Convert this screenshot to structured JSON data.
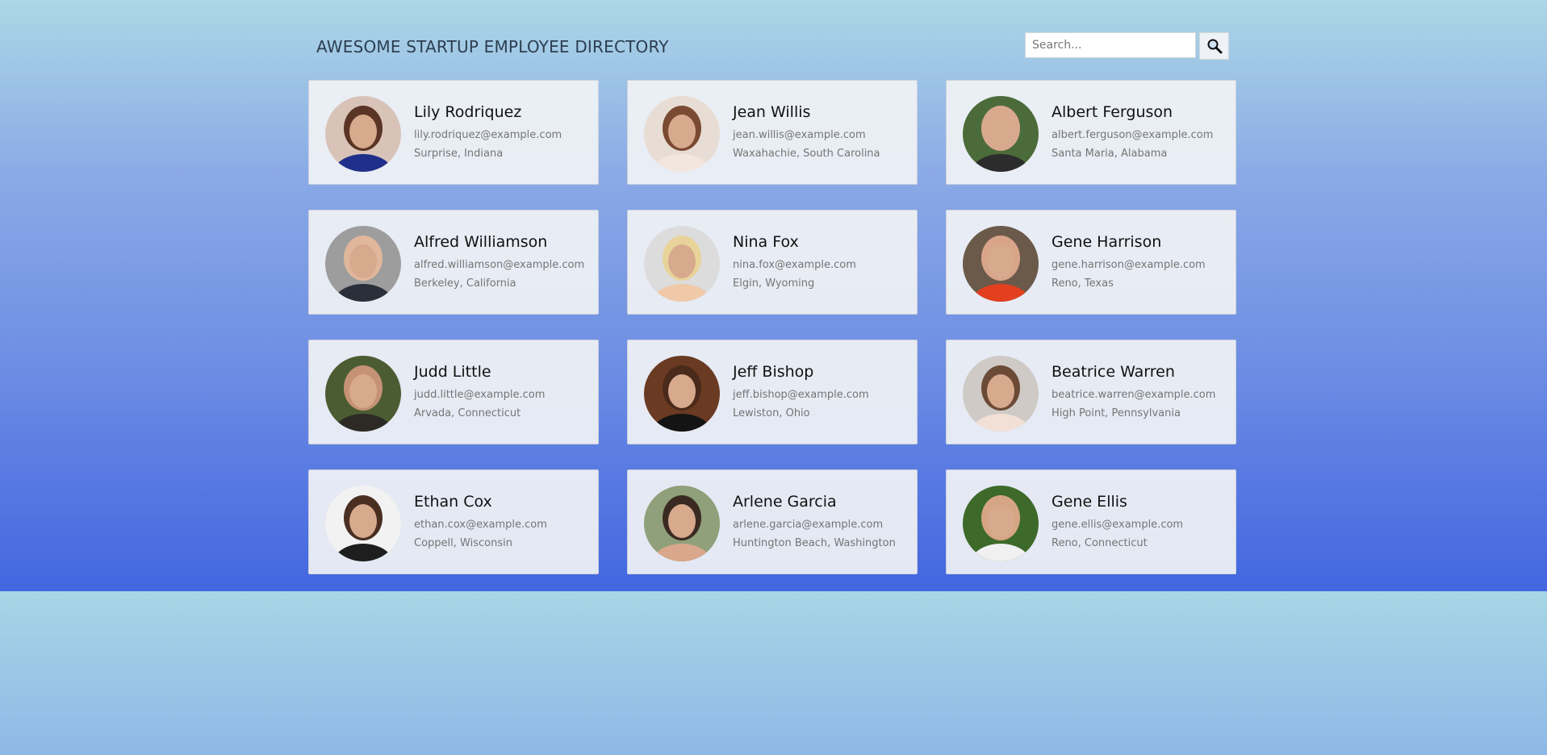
{
  "header": {
    "title": "AWESOME STARTUP EMPLOYEE DIRECTORY"
  },
  "search": {
    "placeholder": "Search...",
    "value": "",
    "button_icon": "magnifying-glass-icon"
  },
  "employees": [
    {
      "name": "Lily Rodriquez",
      "email": "lily.rodriquez@example.com",
      "location": "Surprise, Indiana",
      "avatar_colors": [
        "#d9c3b8",
        "#5a3424",
        "#1f2f8a"
      ]
    },
    {
      "name": "Jean Willis",
      "email": "jean.willis@example.com",
      "location": "Waxahachie, South Carolina",
      "avatar_colors": [
        "#e8ddd4",
        "#7a4a32",
        "#f2e6df"
      ]
    },
    {
      "name": "Albert Ferguson",
      "email": "albert.ferguson@example.com",
      "location": "Santa Maria, Alabama",
      "avatar_colors": [
        "#4c6b3a",
        "#d9a98e",
        "#2c2c2c"
      ]
    },
    {
      "name": "Alfred Williamson",
      "email": "alfred.williamson@example.com",
      "location": "Berkeley, California",
      "avatar_colors": [
        "#9d9d9d",
        "#e1b79c",
        "#2a2f3a"
      ]
    },
    {
      "name": "Nina Fox",
      "email": "nina.fox@example.com",
      "location": "Elgin, Wyoming",
      "avatar_colors": [
        "#dcdcdc",
        "#e8d49a",
        "#f0c9a8"
      ]
    },
    {
      "name": "Gene Harrison",
      "email": "gene.harrison@example.com",
      "location": "Reno, Texas",
      "avatar_colors": [
        "#6b5a4a",
        "#d9a58a",
        "#e2401f"
      ]
    },
    {
      "name": "Judd Little",
      "email": "judd.little@example.com",
      "location": "Arvada, Connecticut",
      "avatar_colors": [
        "#4b5c33",
        "#c59275",
        "#2d2a26"
      ]
    },
    {
      "name": "Jeff Bishop",
      "email": "jeff.bishop@example.com",
      "location": "Lewiston, Ohio",
      "avatar_colors": [
        "#6a3a22",
        "#4a2a1a",
        "#141414"
      ]
    },
    {
      "name": "Beatrice Warren",
      "email": "beatrice.warren@example.com",
      "location": "High Point, Pennsylvania",
      "avatar_colors": [
        "#cfcac6",
        "#6b4a36",
        "#f2dfd6"
      ]
    },
    {
      "name": "Ethan Cox",
      "email": "ethan.cox@example.com",
      "location": "Coppell, Wisconsin",
      "avatar_colors": [
        "#f2f2f2",
        "#4a2e22",
        "#1e1e1e"
      ]
    },
    {
      "name": "Arlene Garcia",
      "email": "arlene.garcia@example.com",
      "location": "Huntington Beach, Washington",
      "avatar_colors": [
        "#8fa07a",
        "#3a2a22",
        "#d9a78c"
      ]
    },
    {
      "name": "Gene Ellis",
      "email": "gene.ellis@example.com",
      "location": "Reno, Connecticut",
      "avatar_colors": [
        "#3d6a2a",
        "#d6a583",
        "#f0f0f0"
      ]
    }
  ]
}
